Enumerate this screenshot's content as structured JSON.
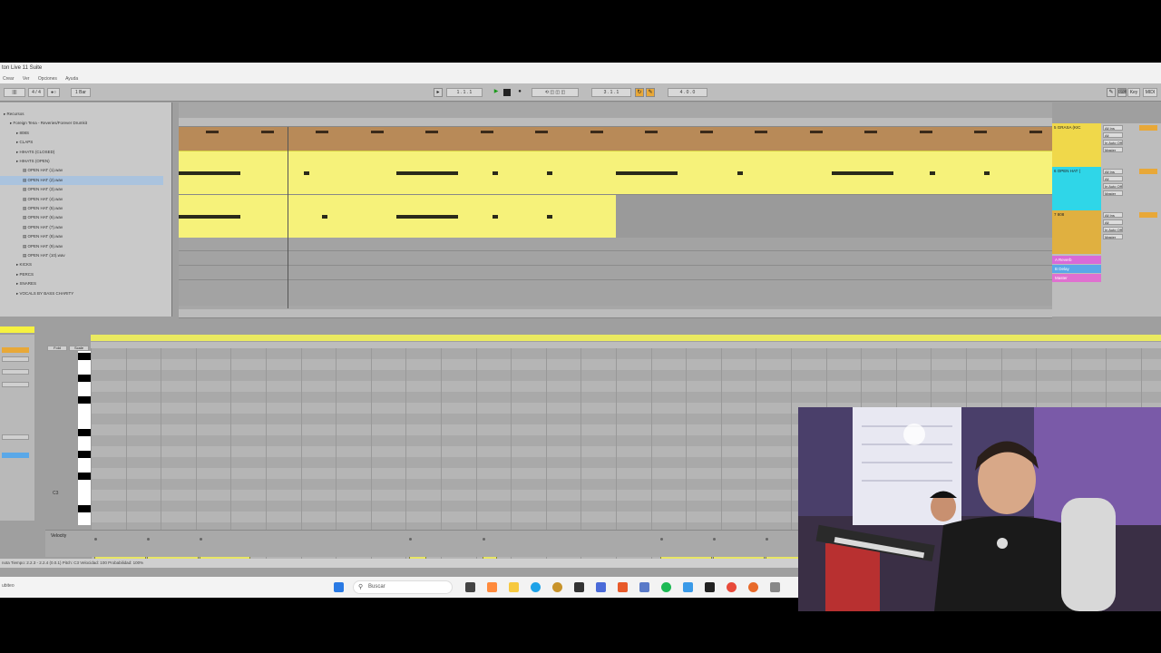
{
  "window": {
    "title": "ton Live 11 Suite"
  },
  "menu": [
    "Crear",
    "Ver",
    "Opciones",
    "Ayuda"
  ],
  "transport": {
    "tempo_sig": "4 / 4",
    "quant": "1 Bar",
    "position": "1 . 1 . 1",
    "loop_start": "3 . 1 . 1",
    "loop_len": "4 . 0 . 0",
    "key_label": "Key",
    "midi_label": "MIDI"
  },
  "browser": {
    "items": [
      {
        "label": "Recursos",
        "indent": 0
      },
      {
        "label": "Foreign Tena - Reveries/Forever Drumkit",
        "indent": 1
      },
      {
        "label": "808S",
        "indent": 2
      },
      {
        "label": "CLAPS",
        "indent": 2
      },
      {
        "label": "HIHATS (CLOSED)",
        "indent": 2
      },
      {
        "label": "HIHATS (OPEN)",
        "indent": 2
      },
      {
        "label": "OPEN HAT (1).wav",
        "indent": 3
      },
      {
        "label": "OPEN HAT (2).wav",
        "indent": 3,
        "selected": true
      },
      {
        "label": "OPEN HAT (3).wav",
        "indent": 3
      },
      {
        "label": "OPEN HAT (4).wav",
        "indent": 3
      },
      {
        "label": "OPEN HAT (5).wav",
        "indent": 3
      },
      {
        "label": "OPEN HAT (6).wav",
        "indent": 3
      },
      {
        "label": "OPEN HAT (7).wav",
        "indent": 3
      },
      {
        "label": "OPEN HAT (8).wav",
        "indent": 3
      },
      {
        "label": "OPEN HAT (9).wav",
        "indent": 3
      },
      {
        "label": "OPEN HAT (10).wav",
        "indent": 3
      },
      {
        "label": "KICKS",
        "indent": 2
      },
      {
        "label": "PERCS",
        "indent": 2
      },
      {
        "label": "SNARES",
        "indent": 2
      },
      {
        "label": "VOCALS BY BASS CHARITY",
        "indent": 2
      }
    ]
  },
  "mixer": {
    "tracks": [
      {
        "name": "5 GRASA (KIC",
        "color": "#f0d84a",
        "input": "All Ins",
        "channel": "All Channe",
        "monitor": "In Auto Off",
        "output": "Master"
      },
      {
        "name": "6 OPEN HAT (",
        "color": "#2fd6e8",
        "input": "All Ins",
        "channel": "All Channe",
        "monitor": "In Auto Off",
        "output": "Master"
      },
      {
        "name": "7 808",
        "color": "#e0b040",
        "input": "All Ins",
        "channel": "All Channe",
        "monitor": "In Auto Off",
        "output": "Master"
      }
    ],
    "returns": [
      {
        "name": "A Reverb",
        "color": "#d86ad8"
      },
      {
        "name": "B Delay",
        "color": "#5aa8e8"
      },
      {
        "name": "Master",
        "color": "#e070d0"
      }
    ]
  },
  "detail": {
    "fold_label": "Fold",
    "scale_label": "Scale",
    "velocity_label": "Velocity",
    "note_label": "C3",
    "notes": [
      {
        "label": "C3",
        "start": 0,
        "len": 1
      },
      {
        "label": "C3",
        "start": 1,
        "len": 1
      },
      {
        "label": "C3",
        "start": 2,
        "len": 1
      },
      {
        "label": "C3",
        "start": 6,
        "len": 0.35
      },
      {
        "label": "C3",
        "start": 7.4,
        "len": 0.3
      },
      {
        "label": "C3",
        "start": 10.8,
        "len": 1
      },
      {
        "label": "C3",
        "start": 11.8,
        "len": 1
      },
      {
        "label": "C3",
        "start": 12.8,
        "len": 1
      }
    ]
  },
  "status": {
    "text": "nota  Tiempo: 2.2.3 - 2.2.4 (0.0.1)  Pitch: C3  Velocidad: 100  Probabilidad: 100%"
  },
  "taskbar": {
    "search_placeholder": "Buscar",
    "bottom_left": "ubiteo"
  }
}
